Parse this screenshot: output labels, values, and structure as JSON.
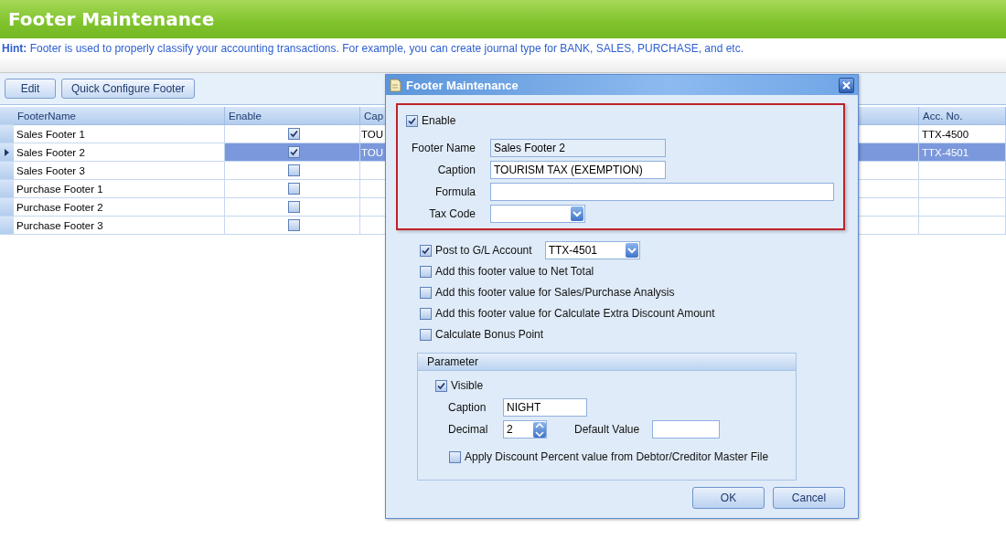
{
  "page_title": "Footer Maintenance",
  "hint": {
    "label": "Hint:",
    "text": "Footer is used to properly classify your accounting transactions. For example, you can create journal type for BANK, SALES, PURCHASE, and etc."
  },
  "toolbar": [
    "Edit",
    "Quick Configure Footer"
  ],
  "grid": {
    "columns": [
      "FooterName",
      "Enable",
      "Cap",
      "Acc. No."
    ],
    "rows": [
      {
        "name": "Sales Footer 1",
        "enabled": true,
        "caption": "TOU",
        "acc_no": "TTX-4500",
        "selected": false
      },
      {
        "name": "Sales Footer 2",
        "enabled": true,
        "caption": "TOU",
        "acc_no": "TTX-4501",
        "selected": true
      },
      {
        "name": "Sales Footer 3",
        "enabled": false,
        "selected": false
      },
      {
        "name": "Purchase Footer 1",
        "enabled": false,
        "selected": false
      },
      {
        "name": "Purchase Footer 2",
        "enabled": false,
        "selected": false
      },
      {
        "name": "Purchase Footer 3",
        "enabled": false,
        "selected": false
      }
    ]
  },
  "dialog": {
    "title": "Footer Maintenance",
    "enable": {
      "label": "Enable",
      "checked": true
    },
    "fields": [
      {
        "label": "Footer Name",
        "value": "Sales Footer 2",
        "kind": "readonly"
      },
      {
        "label": "Caption",
        "value": "TOURISM TAX (EXEMPTION)",
        "kind": "text"
      },
      {
        "label": "Formula",
        "kind": "wide"
      },
      {
        "label": "Tax Code",
        "kind": "dropdown"
      }
    ],
    "options": [
      {
        "label": "Post to G/L Account",
        "checked": true,
        "kind": "account",
        "value": "TTX-4501"
      },
      {
        "label": "Add this footer value to Net Total",
        "checked": false,
        "kind": "plain"
      },
      {
        "label": "Add this footer value for Sales/Purchase Analysis",
        "checked": false,
        "kind": "plain"
      },
      {
        "label": "Add this footer value for Calculate Extra Discount Amount",
        "checked": false,
        "kind": "plain"
      },
      {
        "label": "Calculate Bonus Point",
        "checked": false,
        "kind": "plain"
      }
    ],
    "parameter": {
      "title": "Parameter",
      "visible": {
        "label": "Visible",
        "checked": true
      },
      "caption": {
        "label": "Caption",
        "value": "NIGHT"
      },
      "decimal": {
        "label": "Decimal",
        "value": "2"
      },
      "default_value": {
        "label": "Default Value"
      },
      "apply_discount": {
        "label": "Apply Discount Percent value from Debtor/Creditor Master File",
        "checked": false
      }
    },
    "buttons": [
      "OK",
      "Cancel"
    ]
  }
}
